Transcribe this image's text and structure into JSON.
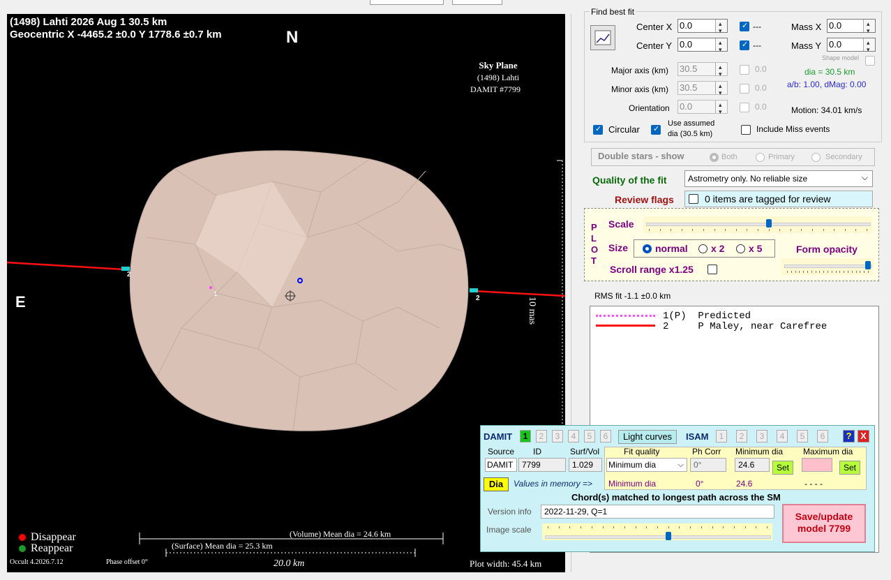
{
  "plot": {
    "title_line1": "(1498) Lahti  2026 Aug 1  30.5 km",
    "title_line2": "Geocentric X -4465.2 ±0.0 Y 1778.6 ±0.7 km",
    "north": "N",
    "east": "E",
    "sky_plane": "Sky Plane",
    "sky_object": "(1498) Lahti",
    "sky_damit": "DAMIT #7799",
    "scale_label": "10 mas",
    "chord1": "1",
    "chord2": "2",
    "chord2b": "2",
    "legend_disappear": "Disappear",
    "legend_reappear": "Reappear",
    "version": "Occult 4.2026.7.12",
    "phase_offset": "Phase offset 0°",
    "volume_dia": "(Volume) Mean dia = 24.6 km",
    "surface_dia": "(Surface) Mean dia = 25.3 km",
    "scale_bar": "20.0 km",
    "plot_width": "Plot width: 45.4 km",
    "colors": {
      "disappear": "#ff0000",
      "reappear": "#1a9b2a",
      "chord": "#ff1010",
      "shape": "#d9c1b6"
    }
  },
  "fit": {
    "group_title": "Find best fit",
    "center_x_label": "Center X",
    "center_x": "0.0",
    "center_y_label": "Center Y",
    "center_y": "0.0",
    "center_x_cb": "---",
    "center_y_cb": "---",
    "mass_x_label": "Mass X",
    "mass_x": "0.0",
    "mass_y_label": "Mass Y",
    "mass_y": "0.0",
    "shape_model": "Shape model",
    "major_label": "Major axis (km)",
    "major": "30.5",
    "major_cb": "0.0",
    "minor_label": "Minor axis (km)",
    "minor": "30.5",
    "minor_cb": "0.0",
    "orient_label": "Orientation",
    "orient": "0.0",
    "orient_cb": "0.0",
    "dia": "dia = 30.5 km",
    "ab": "a/b: 1.00, dMag: 0.00",
    "motion": "Motion: 34.01 km/s",
    "circular": "Circular",
    "use_assumed_1": "Use assumed",
    "use_assumed_2": "dia (30.5 km)",
    "include_miss": "Include Miss events"
  },
  "double": {
    "label": "Double stars - show",
    "both": "Both",
    "primary": "Primary",
    "secondary": "Secondary"
  },
  "quality": {
    "label": "Quality of the fit",
    "value": "Astrometry only. No reliable size",
    "review_label": "Review flags",
    "review_value": "0 items are tagged for review"
  },
  "plotctl": {
    "plot_letters": [
      "P",
      "L",
      "O",
      "T"
    ],
    "scale": "Scale",
    "size": "Size",
    "normal": "normal",
    "x2": "x 2",
    "x5": "x 5",
    "form_opacity": "Form opacity",
    "scroll_range": "Scroll range x1.25",
    "scale_pos": 0.55,
    "opacity_pos": 1.0
  },
  "rms": "RMS fit -1.1 ±0.0 km",
  "observers": [
    {
      "num": "1(P)",
      "name": "Predicted"
    },
    {
      "num": "2",
      "name": "P Maley, near Carefree"
    }
  ],
  "damit": {
    "label": "DAMIT",
    "nums": [
      "1",
      "2",
      "3",
      "4",
      "5",
      "6"
    ],
    "light_curves": "Light curves",
    "isam": "ISAM",
    "isam_nums": [
      "1",
      "2",
      "3",
      "4",
      "5",
      "6"
    ],
    "help": "?",
    "close": "X",
    "h_source": "Source",
    "h_id": "ID",
    "h_surfvol": "Surf/Vol",
    "h_fitq": "Fit quality",
    "h_phcorr": "Ph Corr",
    "h_mindia": "Minimum dia",
    "h_maxdia": "Maximum dia",
    "source": "DAMIT",
    "id": "7799",
    "surfvol": "1.029",
    "fitq": "Minimum dia",
    "phcorr": "0°",
    "mindia": "24.6",
    "set": "Set",
    "set2": "Set",
    "dia_btn": "Dia",
    "values_mem": "Values in memory =>",
    "mem_fitq": "Minimum dia",
    "mem_ph": "0°",
    "mem_min": "24.6",
    "mem_max": "- - - -",
    "chords_note": "Chord(s) matched to longest path across the SM",
    "version_label": "Version info",
    "version": "2022-11-29, Q=1",
    "image_scale": "Image scale",
    "save1": "Save/update",
    "save2": "model 7799",
    "image_scale_pos": 0.55
  }
}
